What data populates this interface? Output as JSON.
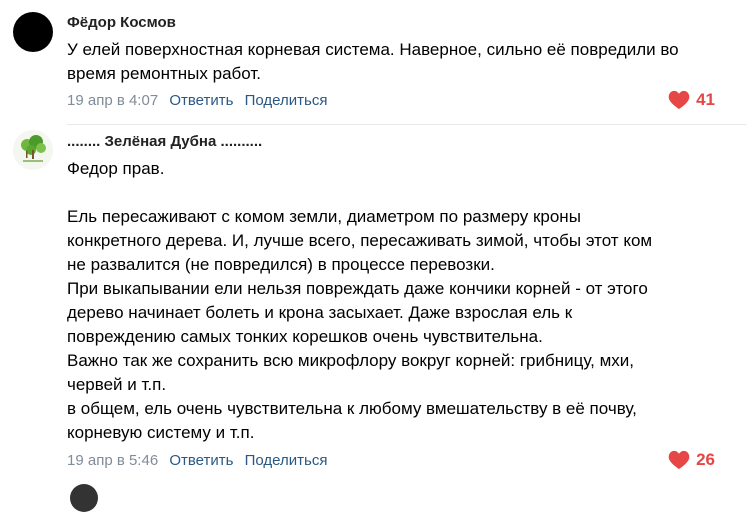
{
  "comments": [
    {
      "author": "Фёдор Космов",
      "text": "У елей поверхностная корневая система. Наверное, сильно её повредили во\nвремя ремонтных работ.",
      "time": "19 апр в 4:07",
      "reply_label": "Ответить",
      "share_label": "Поделиться",
      "likes": "41"
    },
    {
      "author": "........ Зелёная Дубна ..........",
      "text": "Федор прав.\n\nЕль пересаживают с комом земли, диаметром по размеру кроны\nконкретного дерева. И, лучше всего, пересаживать зимой, чтобы этот ком\nне развалится (не повредился) в процессе перевозки.\nПри выкапывании ели нельзя повреждать даже кончики корней - от этого\nдерево начинает болеть и крона засыхает. Даже взрослая ель к\nповреждению самых тонких корешков очень чувствительна.\nВажно так же сохранить всю микрофлору вокруг корней: грибницу, мхи,\nчервей и т.п.\nв общем, ель очень чувствительна к любому вмешательству в её почву,\nкорневую систему и т.п.",
      "time": "19 апр в 5:46",
      "reply_label": "Ответить",
      "share_label": "Поделиться",
      "likes": "26"
    }
  ],
  "colors": {
    "link": "#2a5885",
    "meta": "#818c99",
    "like": "#e64646"
  }
}
